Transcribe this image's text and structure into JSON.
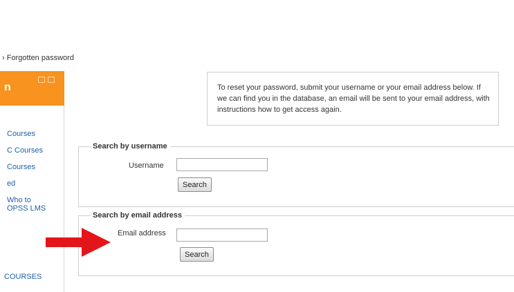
{
  "breadcrumb": {
    "text": "› Forgotten password"
  },
  "sidebar": {
    "header_title": "n",
    "links": [
      "Courses",
      "C Courses",
      "Courses",
      "ed",
      "Who to",
      "OPSS LMS"
    ],
    "bottom_link": "COURSES"
  },
  "info": {
    "text": "To reset your password, submit your username or your email address below. If we can find you in the database, an email will be sent to your email address, with instructions how to get access again."
  },
  "search_by_username": {
    "legend": "Search by username",
    "field_label": "Username",
    "field_value": "",
    "button_label": "Search"
  },
  "search_by_email": {
    "legend": "Search by email address",
    "field_label": "Email address",
    "field_value": "",
    "button_label": "Search"
  },
  "colors": {
    "sidebar_header": "#f7931e",
    "link": "#1f5fa5",
    "arrow": "#e3151b"
  },
  "icons": {
    "arrow": "red-arrow-pointer",
    "sidebar_controls": "block-control-icons"
  }
}
